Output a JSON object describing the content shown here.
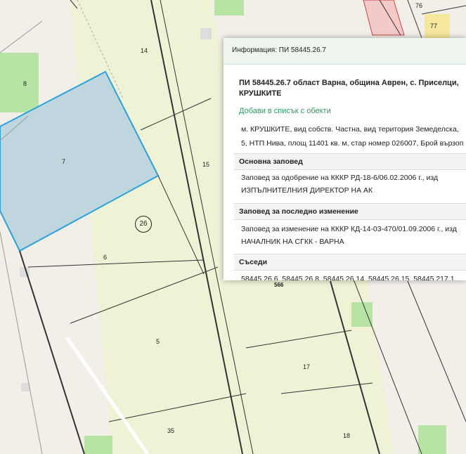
{
  "map": {
    "parcel_labels": [
      "14",
      "8",
      "7",
      "15",
      "6",
      "5",
      "566",
      "17",
      "35",
      "18",
      "76",
      "77"
    ],
    "block_number": "26",
    "colors": {
      "background": "#f2efe9",
      "parcel_fill": "#f0f2d5",
      "selected_fill": "#bfd6df",
      "selected_border": "#29a3dc",
      "green_patch": "#b7e3a4"
    }
  },
  "panel": {
    "header": "Информация: ПИ 58445.26.7",
    "title_line1": "ПИ 58445.26.7 област Варна, община Аврен, с. Приселци,",
    "title_line2": "КРУШКИТЕ",
    "add_link": "Добави в списък с обекти",
    "desc_line1": "м. КРУШКИТЕ, вид собств. Частна, вид територия Земеделска,",
    "desc_line2": "5, НТП Нива, площ 11401 кв. м, стар номер 026007, Брой вързоп",
    "sections": [
      {
        "title": "Основна заповед",
        "line1": "Заповед за одобрение на КККР РД-18-6/06.02.2006 г., изд",
        "line2": "ИЗПЪЛНИТЕЛНИЯ ДИРЕКТОР НА АК"
      },
      {
        "title": "Заповед за последно изменение",
        "line1": "Заповед за изменение на КККР КД-14-03-470/01.09.2006 г., изд",
        "line2": "НАЧАЛНИК НА СГКК - ВАРНА"
      },
      {
        "title": "Съседи",
        "line1": "58445.26.6, 58445.26.8, 58445.26.14, 58445.26.15, 58445.217.1",
        "line2": ""
      }
    ]
  }
}
